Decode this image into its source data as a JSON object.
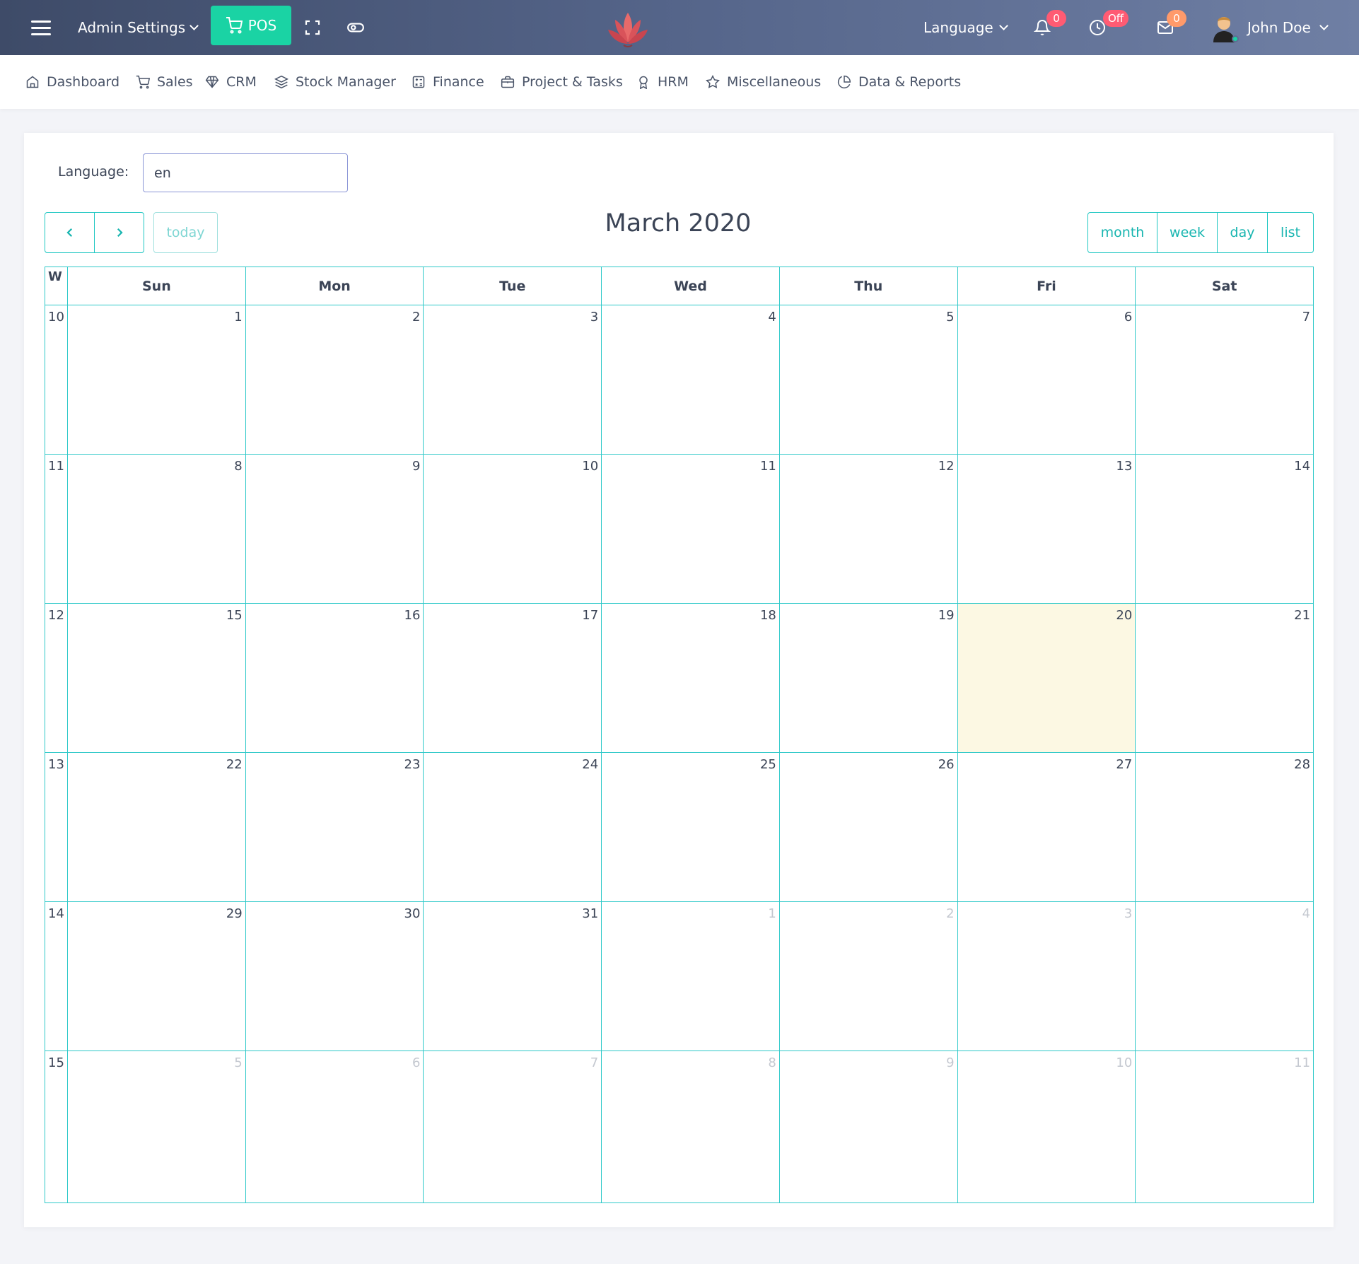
{
  "topbar": {
    "admin_settings": "Admin Settings",
    "pos_label": "POS",
    "language_label": "Language",
    "notifications_count": "0",
    "clock_status": "Off",
    "messages_count": "0",
    "user_name": "John Doe"
  },
  "nav": {
    "items": [
      {
        "label": "Dashboard",
        "icon": "home-icon"
      },
      {
        "label": "Sales",
        "icon": "cart-icon"
      },
      {
        "label": "CRM",
        "icon": "diamond-icon"
      },
      {
        "label": "Stock Manager",
        "icon": "layers-icon"
      },
      {
        "label": "Finance",
        "icon": "calculator-icon"
      },
      {
        "label": "Project & Tasks",
        "icon": "briefcase-icon"
      },
      {
        "label": "HRM",
        "icon": "award-icon"
      },
      {
        "label": "Miscellaneous",
        "icon": "star-icon"
      },
      {
        "label": "Data & Reports",
        "icon": "pie-icon"
      }
    ]
  },
  "form": {
    "language_label": "Language:",
    "language_value": "en"
  },
  "calendar": {
    "title": "March 2020",
    "today_label": "today",
    "views": [
      "month",
      "week",
      "day",
      "list"
    ],
    "week_header": "W",
    "days_of_week": [
      "Sun",
      "Mon",
      "Tue",
      "Wed",
      "Thu",
      "Fri",
      "Sat"
    ],
    "weeks": [
      {
        "week": "10",
        "days": [
          {
            "d": "1"
          },
          {
            "d": "2"
          },
          {
            "d": "3"
          },
          {
            "d": "4"
          },
          {
            "d": "5"
          },
          {
            "d": "6"
          },
          {
            "d": "7"
          }
        ]
      },
      {
        "week": "11",
        "days": [
          {
            "d": "8"
          },
          {
            "d": "9"
          },
          {
            "d": "10"
          },
          {
            "d": "11"
          },
          {
            "d": "12"
          },
          {
            "d": "13"
          },
          {
            "d": "14"
          }
        ]
      },
      {
        "week": "12",
        "days": [
          {
            "d": "15"
          },
          {
            "d": "16"
          },
          {
            "d": "17"
          },
          {
            "d": "18"
          },
          {
            "d": "19"
          },
          {
            "d": "20",
            "today": true
          },
          {
            "d": "21"
          }
        ]
      },
      {
        "week": "13",
        "days": [
          {
            "d": "22"
          },
          {
            "d": "23"
          },
          {
            "d": "24"
          },
          {
            "d": "25"
          },
          {
            "d": "26"
          },
          {
            "d": "27"
          },
          {
            "d": "28"
          }
        ]
      },
      {
        "week": "14",
        "days": [
          {
            "d": "29"
          },
          {
            "d": "30"
          },
          {
            "d": "31"
          },
          {
            "d": "1",
            "other": true
          },
          {
            "d": "2",
            "other": true
          },
          {
            "d": "3",
            "other": true
          },
          {
            "d": "4",
            "other": true
          }
        ]
      },
      {
        "week": "15",
        "days": [
          {
            "d": "5",
            "other": true
          },
          {
            "d": "6",
            "other": true
          },
          {
            "d": "7",
            "other": true
          },
          {
            "d": "8",
            "other": true
          },
          {
            "d": "9",
            "other": true
          },
          {
            "d": "10",
            "other": true
          },
          {
            "d": "11",
            "other": true
          }
        ]
      }
    ]
  },
  "colors": {
    "accent": "#1ec7c2",
    "pos_button": "#1ad3a4",
    "today_highlight": "#fcf8e3",
    "badge_red": "#ff5b73",
    "badge_orange": "#ff9a6a"
  }
}
